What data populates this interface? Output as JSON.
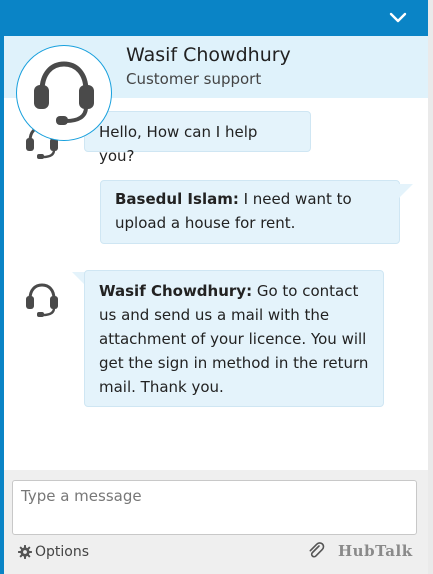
{
  "header": {
    "agent_name": "Wasif Chowdhury",
    "agent_role": "Customer support",
    "avatar_icon": "headset-icon"
  },
  "messages": [
    {
      "from": "agent",
      "sender": "",
      "text": "Hello, How can I help you?"
    },
    {
      "from": "user",
      "sender": "Basedul Islam:",
      "text": " I need want to upload a house for rent."
    },
    {
      "from": "agent",
      "sender": "Wasif Chowdhury:",
      "text": " Go to contact us and send us a mail with the attachment of your licence. You will get the sign in method in the return mail. Thank you."
    }
  ],
  "composer": {
    "placeholder": "Type a message",
    "value": "",
    "options_label": "Options",
    "brand": "HubTalk"
  },
  "colors": {
    "accent": "#0a84c6",
    "header_bg": "#dff2fb",
    "bubble_bg": "#e4f3fb",
    "icon_gray": "#4a4a4a"
  }
}
